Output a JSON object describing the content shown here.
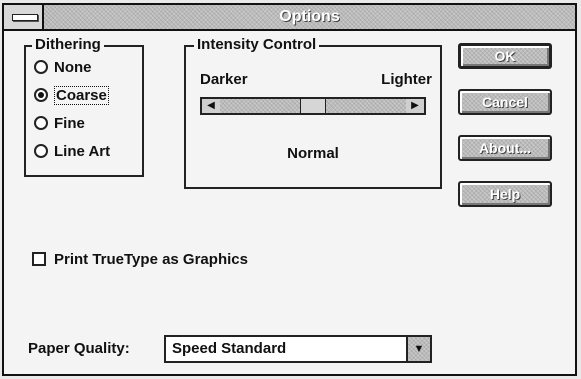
{
  "window": {
    "title": "Options"
  },
  "dithering": {
    "label": "Dithering",
    "options": [
      {
        "label": "None",
        "selected": false
      },
      {
        "label": "Coarse",
        "selected": true
      },
      {
        "label": "Fine",
        "selected": false
      },
      {
        "label": "Line Art",
        "selected": false
      }
    ]
  },
  "intensity": {
    "label": "Intensity Control",
    "darker_label": "Darker",
    "lighter_label": "Lighter",
    "value_label": "Normal",
    "position_fraction": 0.5,
    "left_arrow_icon": "arrow-left-icon",
    "right_arrow_icon": "arrow-right-icon"
  },
  "buttons": {
    "ok": "OK",
    "cancel": "Cancel",
    "about": "About...",
    "help": "Help"
  },
  "print_truetype": {
    "label": "Print TrueType as Graphics",
    "checked": false
  },
  "paper_quality": {
    "label": "Paper Quality:",
    "value": "Speed Standard",
    "dropdown_icon": "arrow-down-icon"
  }
}
